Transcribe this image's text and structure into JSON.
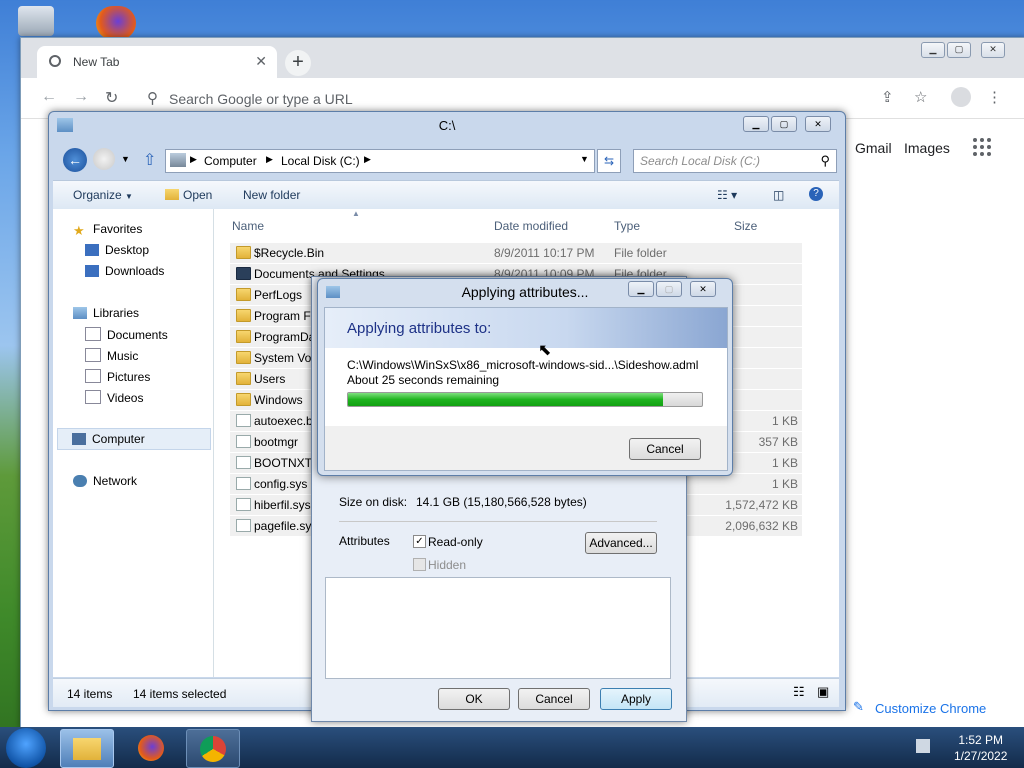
{
  "chrome": {
    "tab_title": "New Tab",
    "tab_close": "✕",
    "newtab": "+",
    "omnibox_placeholder": "Search Google or type a URL",
    "links": {
      "gmail": "Gmail",
      "images": "Images"
    },
    "customize_label": "Customize Chrome"
  },
  "explorer": {
    "title": "C:\\",
    "breadcrumb": [
      "Computer",
      "Local Disk (C:)"
    ],
    "search_placeholder": "Search Local Disk (C:)",
    "commands": {
      "organize": "Organize",
      "open": "Open",
      "new_folder": "New folder"
    },
    "nav": {
      "favorites": "Favorites",
      "desktop": "Desktop",
      "downloads": "Downloads",
      "libraries": "Libraries",
      "documents": "Documents",
      "music": "Music",
      "pictures": "Pictures",
      "videos": "Videos",
      "computer": "Computer",
      "network": "Network"
    },
    "columns": {
      "name": "Name",
      "date": "Date modified",
      "type": "Type",
      "size": "Size"
    },
    "files": [
      {
        "name": "$Recycle.Bin",
        "date": "8/9/2011 10:17 PM",
        "type": "File folder",
        "size": "",
        "kind": "folder"
      },
      {
        "name": "Documents and Settings",
        "date": "8/9/2011 10:09 PM",
        "type": "File folder",
        "size": "",
        "kind": "link"
      },
      {
        "name": "PerfLogs",
        "date": "",
        "type": "",
        "size": "",
        "kind": "folder"
      },
      {
        "name": "Program Fi",
        "date": "",
        "type": "",
        "size": "",
        "kind": "folder"
      },
      {
        "name": "ProgramDa",
        "date": "",
        "type": "",
        "size": "",
        "kind": "folder"
      },
      {
        "name": "System Vol",
        "date": "",
        "type": "",
        "size": "",
        "kind": "folder"
      },
      {
        "name": "Users",
        "date": "",
        "type": "",
        "size": "",
        "kind": "folder"
      },
      {
        "name": "Windows",
        "date": "",
        "type": "",
        "size": "",
        "kind": "folder"
      },
      {
        "name": "autoexec.b",
        "date": "",
        "type": "",
        "size": "1 KB",
        "kind": "file"
      },
      {
        "name": "bootmgr",
        "date": "",
        "type": "",
        "size": "357 KB",
        "kind": "file"
      },
      {
        "name": "BOOTNXT",
        "date": "",
        "type": "",
        "size": "1 KB",
        "kind": "file"
      },
      {
        "name": "config.sys",
        "date": "",
        "type": "",
        "size": "1 KB",
        "kind": "file"
      },
      {
        "name": "hiberfil.sys",
        "date": "",
        "type": "",
        "size": "1,572,472 KB",
        "kind": "file"
      },
      {
        "name": "pagefile.sys",
        "date": "",
        "type": "",
        "size": "2,096,632 KB",
        "kind": "file"
      }
    ],
    "status": {
      "count": "14 items",
      "selected": "14 items selected"
    }
  },
  "properties": {
    "size_on_disk_label": "Size on disk:",
    "size_on_disk_value": "14.1 GB (15,180,566,528 bytes)",
    "attributes_label": "Attributes",
    "readonly_label": "Read-only",
    "hidden_label": "Hidden",
    "advanced_label": "Advanced...",
    "ok_label": "OK",
    "cancel_label": "Cancel",
    "apply_label": "Apply"
  },
  "applying": {
    "title": "Applying attributes...",
    "heading": "Applying attributes to:",
    "path": "C:\\Windows\\WinSxS\\x86_microsoft-windows-sid...\\Sideshow.adml",
    "remaining": "About 25 seconds remaining",
    "progress": 0.89,
    "cancel_label": "Cancel"
  },
  "taskbar": {
    "time": "1:52 PM",
    "date": "1/27/2022"
  }
}
